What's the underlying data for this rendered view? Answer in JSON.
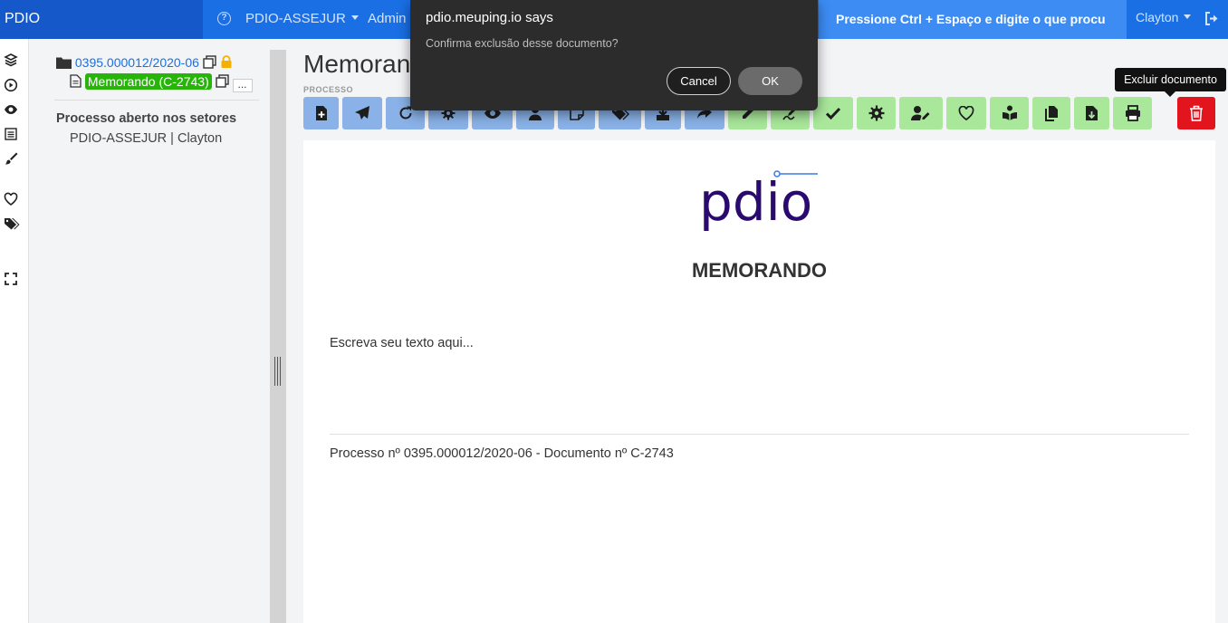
{
  "navbar": {
    "brand": "PDIO",
    "help_icon": "question-circle-icon",
    "sector_menu": "PDIO-ASSEJUR",
    "admin_menu": "Admin",
    "search_prompt": "Pressione Ctrl + Espaço e digite o que procu",
    "user_menu": "Clayton",
    "logout_icon": "sign-out-icon"
  },
  "rail": {
    "icons": [
      "layers-icon",
      "play-circle-icon",
      "eye-icon",
      "calendar-icon",
      "brush-icon",
      "heart-icon",
      "tags-icon",
      "expand-icon"
    ]
  },
  "tree": {
    "process_number": "0395.000012/2020-06",
    "document_badge": "Memorando (C-2743)",
    "more_label": "...",
    "open_sectors_heading": "Processo aberto nos setores",
    "open_sectors_value": "PDIO-ASSEJUR | Clayton"
  },
  "main": {
    "title": "Memorando",
    "section_label": "PROCESSO",
    "delete_tooltip": "Excluir documento"
  },
  "toolbar": {
    "buttons": [
      {
        "icon": "file-plus-icon",
        "color": "blue"
      },
      {
        "icon": "paper-plane-icon",
        "color": "blue"
      },
      {
        "icon": "redo-icon",
        "color": "blue"
      },
      {
        "icon": "cogs-icon",
        "color": "blue"
      },
      {
        "icon": "eye-icon",
        "color": "blue"
      },
      {
        "icon": "user-icon",
        "color": "blue"
      },
      {
        "icon": "sticky-note-icon",
        "color": "blue"
      },
      {
        "icon": "tags-icon",
        "color": "blue"
      },
      {
        "icon": "download-icon",
        "color": "blue"
      },
      {
        "icon": "share-icon",
        "color": "blue"
      },
      {
        "icon": "pencil-icon",
        "color": "green"
      },
      {
        "icon": "signature-pen-icon",
        "color": "green"
      },
      {
        "icon": "check-icon",
        "color": "green"
      },
      {
        "icon": "gear-icon",
        "color": "green"
      },
      {
        "icon": "user-edit-icon",
        "color": "green"
      },
      {
        "icon": "heart-icon",
        "color": "green"
      },
      {
        "icon": "book-reader-icon",
        "color": "green"
      },
      {
        "icon": "copy-icon",
        "color": "green"
      },
      {
        "icon": "file-download-icon",
        "color": "green"
      },
      {
        "icon": "print-icon",
        "color": "green"
      },
      {
        "icon": "trash-icon",
        "color": "red"
      }
    ]
  },
  "document": {
    "logo_text": "pdio",
    "heading": "MEMORANDO",
    "body_text": "Escreva seu texto aqui...",
    "footer_text": "Processo nº 0395.000012/2020-06 - Documento nº C-2743"
  },
  "dialog": {
    "title": "pdio.meuping.io says",
    "message": "Confirma exclusão desse documento?",
    "cancel_label": "Cancel",
    "ok_label": "OK"
  },
  "colors": {
    "navbar": "#1a6fe5",
    "toolbar_blue": "#8ab2e8",
    "toolbar_green": "#a9e79b",
    "danger": "#e2141e",
    "badge_green": "#27b50a",
    "logo_purple": "#2a0a6e"
  }
}
